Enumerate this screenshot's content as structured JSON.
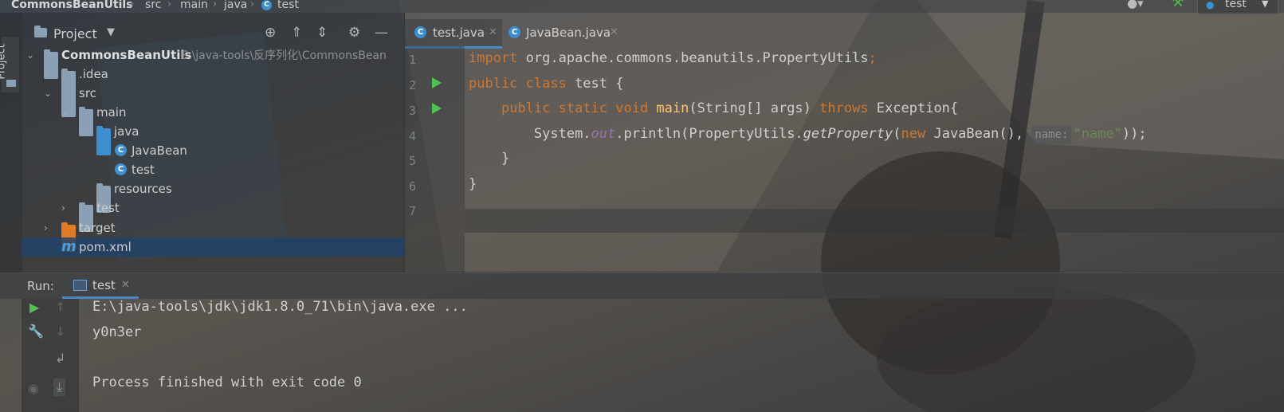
{
  "breadcrumb": {
    "project": "CommonsBeanUtils",
    "items": [
      "src",
      "main",
      "java",
      "test"
    ]
  },
  "toolbar": {
    "run_config": "test"
  },
  "left_strip": {
    "project_tab": "Project"
  },
  "project_panel": {
    "title": "Project",
    "tree": [
      {
        "label": "CommonsBeanUtils",
        "path": "E:\\java-tools\\反序列化\\CommonsBean"
      },
      {
        "label": ".idea"
      },
      {
        "label": "src"
      },
      {
        "label": "main"
      },
      {
        "label": "java"
      },
      {
        "label": "JavaBean"
      },
      {
        "label": "test"
      },
      {
        "label": "resources"
      },
      {
        "label": "test"
      },
      {
        "label": "target"
      },
      {
        "label": "pom.xml"
      }
    ]
  },
  "editor": {
    "tabs": [
      {
        "label": "test.java"
      },
      {
        "label": "JavaBean.java"
      }
    ],
    "line_numbers": [
      "1",
      "2",
      "3",
      "4",
      "5",
      "6",
      "7"
    ],
    "code": {
      "l1_kw": "import",
      "l1_rest": " org.apache.commons.beanutils.PropertyUtils",
      "l1_semi": ";",
      "l2_kw": "public class",
      "l2_rest": " test {",
      "l3_kw1": "public static void",
      "l3_fn": " main",
      "l3_mid": "(String[] args) ",
      "l3_kw2": "throws",
      "l3_rest": " Exception{",
      "l4_a": "System.",
      "l4_field": "out",
      "l4_b": ".println(PropertyUtils.",
      "l4_fn": "getProperty",
      "l4_c": "(",
      "l4_kw": "new",
      "l4_d": " JavaBean(),",
      "l4_hint": "name:",
      "l4_str": "\"name\"",
      "l4_e": "));",
      "l5": "}",
      "l6": "}"
    }
  },
  "run": {
    "label": "Run:",
    "tab": "test",
    "console": [
      "E:\\java-tools\\jdk\\jdk1.8.0_71\\bin\\java.exe ...",
      "y0n3er",
      "",
      "Process finished with exit code 0"
    ]
  }
}
